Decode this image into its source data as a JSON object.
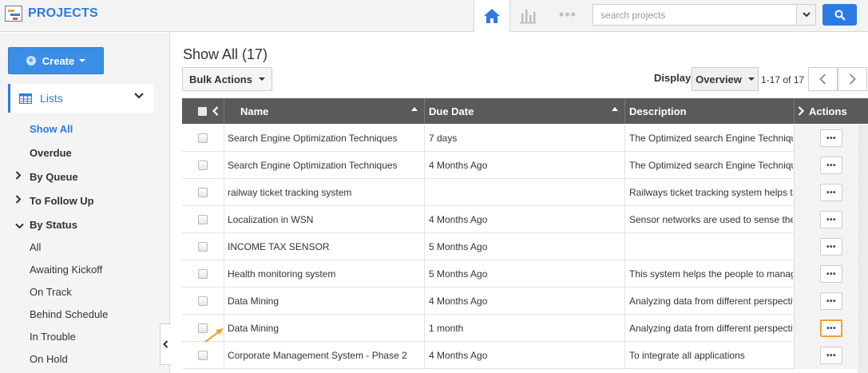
{
  "app": {
    "title": "PROJECTS"
  },
  "search": {
    "placeholder": "search projects"
  },
  "sidebar": {
    "create_label": "Create",
    "lists_label": "Lists",
    "items": [
      {
        "label": "Show All",
        "state": "active"
      },
      {
        "label": "Overdue",
        "state": "bold"
      },
      {
        "label": "By Queue",
        "state": "collapsed-group"
      },
      {
        "label": "To Follow Up",
        "state": "collapsed-group"
      },
      {
        "label": "By Status",
        "state": "expanded-group"
      },
      {
        "label": "All",
        "state": "sub"
      },
      {
        "label": "Awaiting Kickoff",
        "state": "sub"
      },
      {
        "label": "On Track",
        "state": "sub"
      },
      {
        "label": "Behind Schedule",
        "state": "sub"
      },
      {
        "label": "In Trouble",
        "state": "sub"
      },
      {
        "label": "On Hold",
        "state": "sub"
      }
    ]
  },
  "main": {
    "title": "Show All (17)",
    "bulk_actions_label": "Bulk Actions",
    "display_label": "Display",
    "display_value": "Overview",
    "page_count": "1-17 of 17"
  },
  "table": {
    "columns": {
      "name": "Name",
      "due": "Due Date",
      "description": "Description",
      "actions": "Actions"
    },
    "action_glyph": "•••",
    "highlighted_row_index": 7,
    "rows": [
      {
        "name": "Search Engine Optimization Techniques",
        "due": "7 days",
        "description": "The Optimized search Engine Techniques"
      },
      {
        "name": "Search Engine Optimization Techniques",
        "due": "4 Months Ago",
        "description": "The Optimized search Engine Techniques"
      },
      {
        "name": "railway ticket tracking system",
        "due": "",
        "description": "Railways ticket  tracking system helps to"
      },
      {
        "name": "Localization in WSN",
        "due": "4 Months Ago",
        "description": "Sensor networks are used to sense the"
      },
      {
        "name": "INCOME TAX SENSOR",
        "due": "5 Months Ago",
        "description": ""
      },
      {
        "name": "Health monitoring system",
        "due": "5 Months Ago",
        "description": "This system helps the people to manage"
      },
      {
        "name": "Data Mining",
        "due": "4 Months Ago",
        "description": "Analyzing data from different perspectives"
      },
      {
        "name": "Data Mining",
        "due": "1 month",
        "description": "Analyzing data from different perspectives"
      },
      {
        "name": "Corporate Management System - Phase 2",
        "due": "4 Months Ago",
        "description": "To integrate all applications"
      }
    ]
  },
  "colors": {
    "accent": "#2c7be5",
    "header_bg": "#5a5a5a",
    "highlight": "#f5a02a"
  }
}
